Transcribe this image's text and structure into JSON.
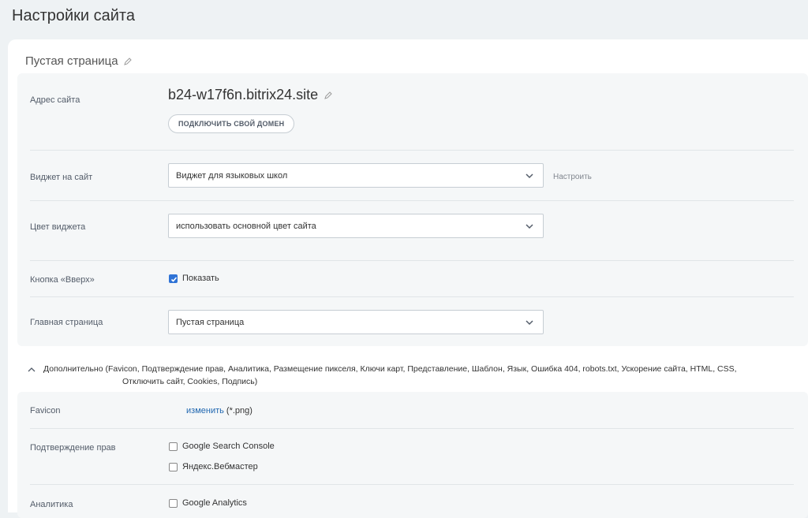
{
  "page": {
    "title": "Настройки сайта"
  },
  "site": {
    "name": "Пустая страница"
  },
  "address": {
    "label": "Адрес сайта",
    "domain": "b24-w17f6n.bitrix24.site",
    "connect_button": "ПОДКЛЮЧИТЬ СВОЙ ДОМЕН"
  },
  "widget": {
    "label": "Виджет на сайт",
    "value": "Виджет для языковых школ",
    "configure": "Настроить"
  },
  "widget_color": {
    "label": "Цвет виджета",
    "value": "использовать основной цвет сайта"
  },
  "up_button": {
    "label": "Кнопка «Вверх»",
    "checkbox_label": "Показать",
    "checked": true
  },
  "home_page": {
    "label": "Главная страница",
    "value": "Пустая страница"
  },
  "additional": {
    "line1": "Дополнительно (Favicon, Подтверждение прав, Аналитика, Размещение пикселя, Ключи карт, Представление, Шаблон, Язык, Ошибка 404, robots.txt, Ускорение сайта, HTML, CSS,",
    "line2": "Отключить сайт, Cookies, Подпись)"
  },
  "favicon": {
    "label": "Favicon",
    "change_link": "изменить",
    "hint": "(*.png)"
  },
  "rights": {
    "label": "Подтверждение прав",
    "options": [
      "Google Search Console",
      "Яндекс.Вебмастер"
    ]
  },
  "analytics": {
    "label": "Аналитика",
    "options": [
      "Google Analytics"
    ]
  },
  "colors": {
    "accent": "#2f73d6",
    "link": "#2067b0",
    "background": "#eef2f4"
  }
}
